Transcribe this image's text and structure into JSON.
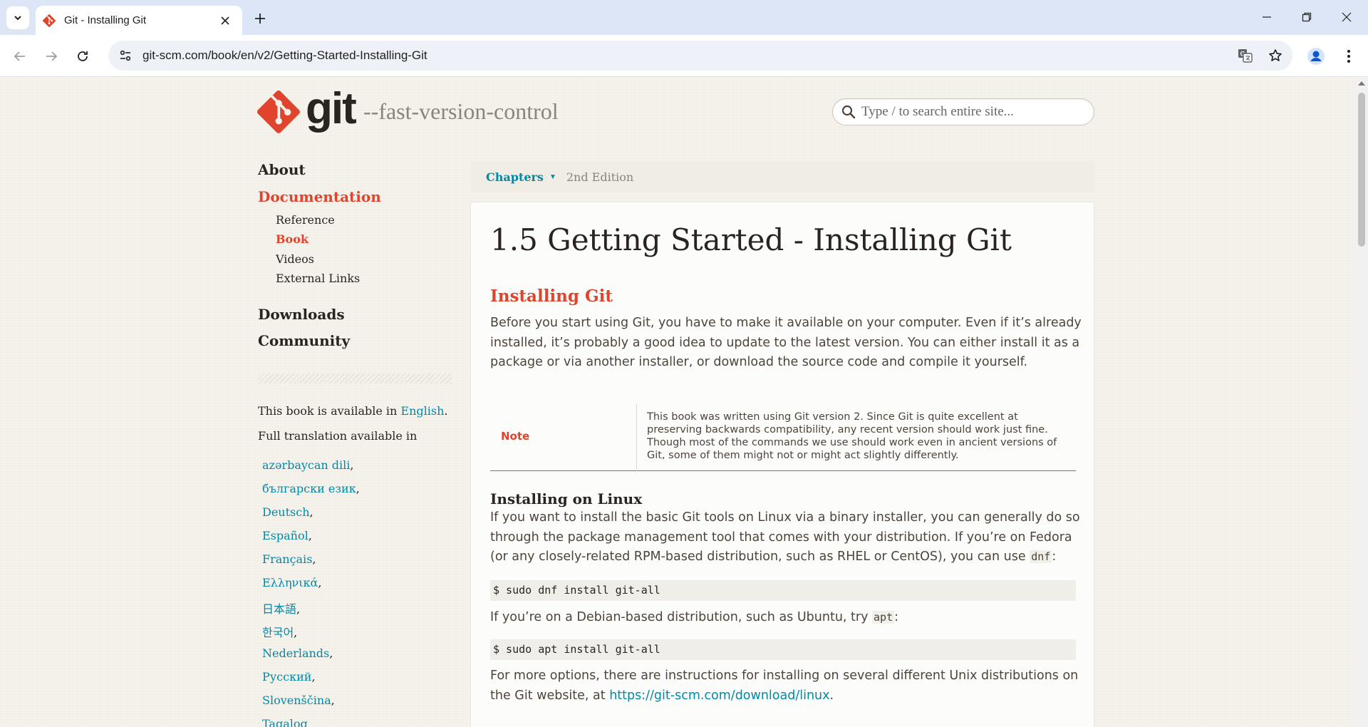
{
  "browser": {
    "tab_title": "Git - Installing Git",
    "url": "git-scm.com/book/en/v2/Getting-Started-Installing-Git"
  },
  "site": {
    "logo_text": "git",
    "tagline": "--fast-version-control",
    "search_placeholder": "Type / to search entire site...",
    "brand_color": "#e0442d",
    "link_color": "#0388a6"
  },
  "sidebar": {
    "about": "About",
    "documentation": "Documentation",
    "doc_items": [
      "Reference",
      "Book",
      "Videos",
      "External Links"
    ],
    "downloads": "Downloads",
    "community": "Community",
    "available_prefix": "This book is available in",
    "available_lang": "English",
    "available_suffix": ".",
    "full_translation": "Full translation available in",
    "languages": [
      "azərbaycan dili",
      "български език",
      "Deutsch",
      "Español",
      "Français",
      "Ελληνικά",
      "日本語",
      "한국어",
      "Nederlands",
      "Русский",
      "Slovenščina",
      "Tagalog"
    ]
  },
  "content": {
    "chapters_label": "Chapters",
    "edition": "2nd Edition",
    "title": "1.5 Getting Started - Installing Git",
    "section_title": "Installing Git",
    "intro_paragraph": "Before you start using Git, you have to make it available on your computer. Even if it’s already installed, it’s probably a good idea to update to the latest version. You can either install it as a package or via another installer, or download the source code and compile it yourself.",
    "note_label": "Note",
    "note_text": "This book was written using Git version 2. Since Git is quite excellent at preserving backwards compatibility, any recent version should work just fine. Though most of the commands we use should work even in ancient versions of Git, some of them might not or might act slightly differently.",
    "linux_heading": "Installing on Linux",
    "linux_paragraph_before": "If you want to install the basic Git tools on Linux via a binary installer, you can generally do so through the package management tool that comes with your distribution. If you’re on Fedora (or any closely-related RPM-based distribution, such as RHEL or CentOS), you can use ",
    "linux_paragraph_code": "dnf",
    "linux_paragraph_after": ":",
    "cmd_dnf": "$ sudo dnf install git-all",
    "debian_before": "If you’re on a Debian-based distribution, such as Ubuntu, try ",
    "debian_code": "apt",
    "debian_after": ":",
    "cmd_apt": "$ sudo apt install git-all",
    "more_before": "For more options, there are instructions for installing on several different Unix distributions on the Git website, at ",
    "more_link": "https://git-scm.com/download/linux",
    "more_after": "."
  }
}
